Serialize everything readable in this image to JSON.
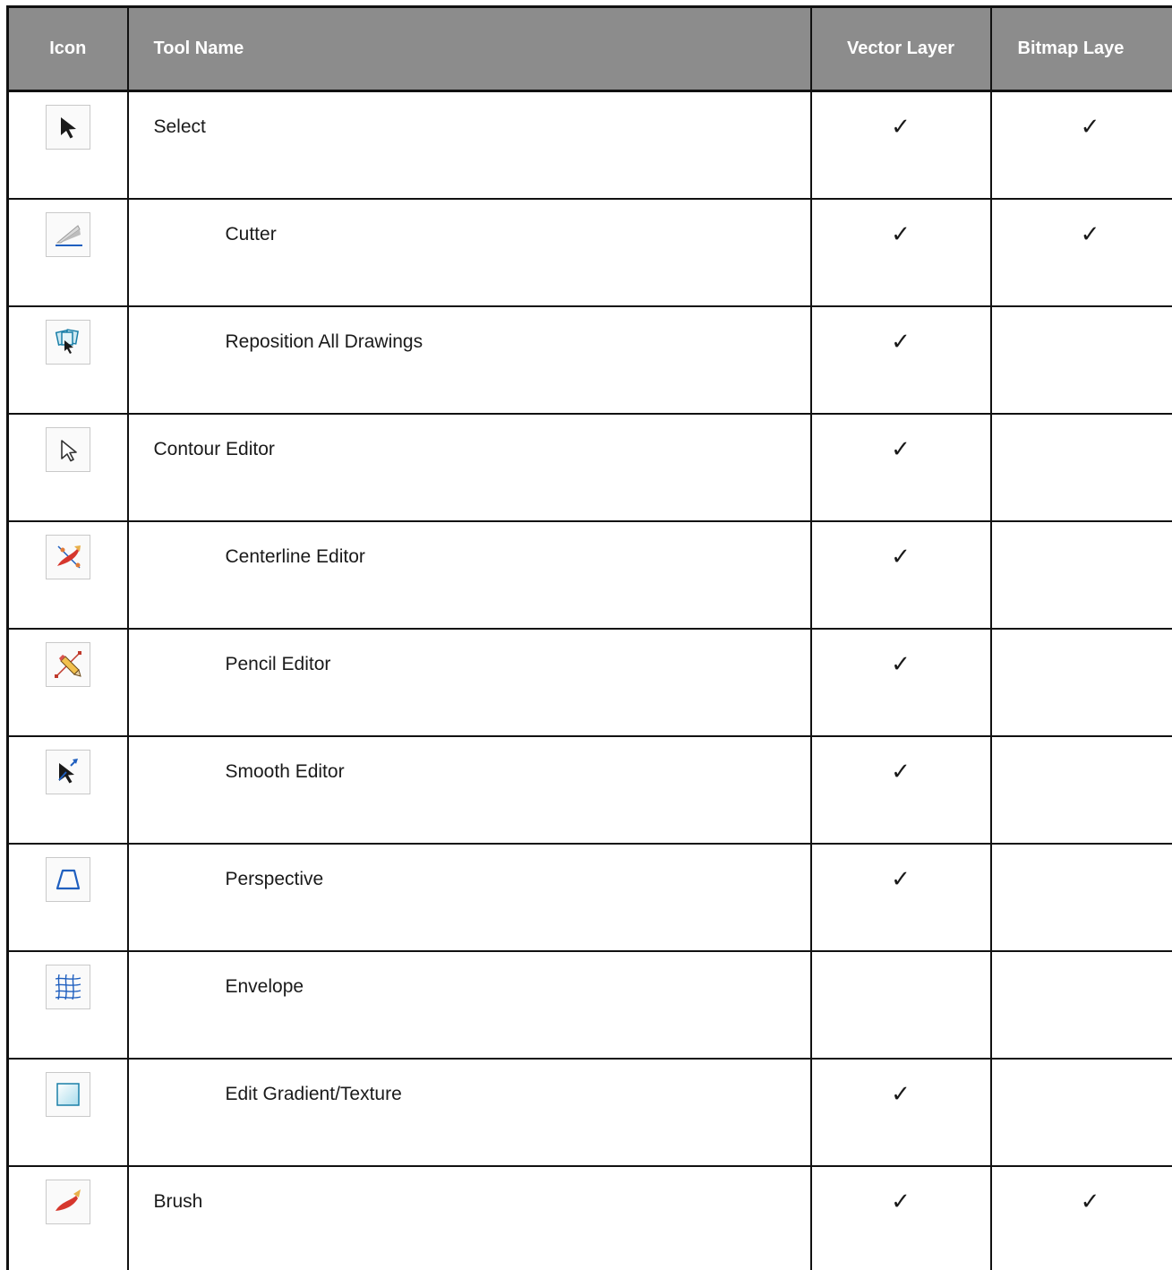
{
  "headers": {
    "icon": "Icon",
    "tool_name": "Tool Name",
    "vector_layer": "Vector Layer",
    "bitmap_layer": "Bitmap Laye"
  },
  "check_mark": "✓",
  "rows": [
    {
      "icon": "select-arrow-icon",
      "name": "Select",
      "indent": false,
      "vector": true,
      "bitmap": true
    },
    {
      "icon": "cutter-icon",
      "name": "Cutter",
      "indent": true,
      "vector": true,
      "bitmap": true
    },
    {
      "icon": "reposition-all-drawings-icon",
      "name": "Reposition All Drawings",
      "indent": true,
      "vector": true,
      "bitmap": false
    },
    {
      "icon": "contour-editor-icon",
      "name": "Contour Editor",
      "indent": false,
      "vector": true,
      "bitmap": false
    },
    {
      "icon": "centerline-editor-icon",
      "name": "Centerline Editor",
      "indent": true,
      "vector": true,
      "bitmap": false
    },
    {
      "icon": "pencil-editor-icon",
      "name": "Pencil Editor",
      "indent": true,
      "vector": true,
      "bitmap": false
    },
    {
      "icon": "smooth-editor-icon",
      "name": "Smooth Editor",
      "indent": true,
      "vector": true,
      "bitmap": false
    },
    {
      "icon": "perspective-icon",
      "name": "Perspective",
      "indent": true,
      "vector": true,
      "bitmap": false
    },
    {
      "icon": "envelope-icon",
      "name": "Envelope",
      "indent": true,
      "vector": false,
      "bitmap": false
    },
    {
      "icon": "edit-gradient-texture-icon",
      "name": "Edit Gradient/Texture",
      "indent": true,
      "vector": true,
      "bitmap": false
    },
    {
      "icon": "brush-icon",
      "name": "Brush",
      "indent": false,
      "vector": true,
      "bitmap": true
    }
  ]
}
